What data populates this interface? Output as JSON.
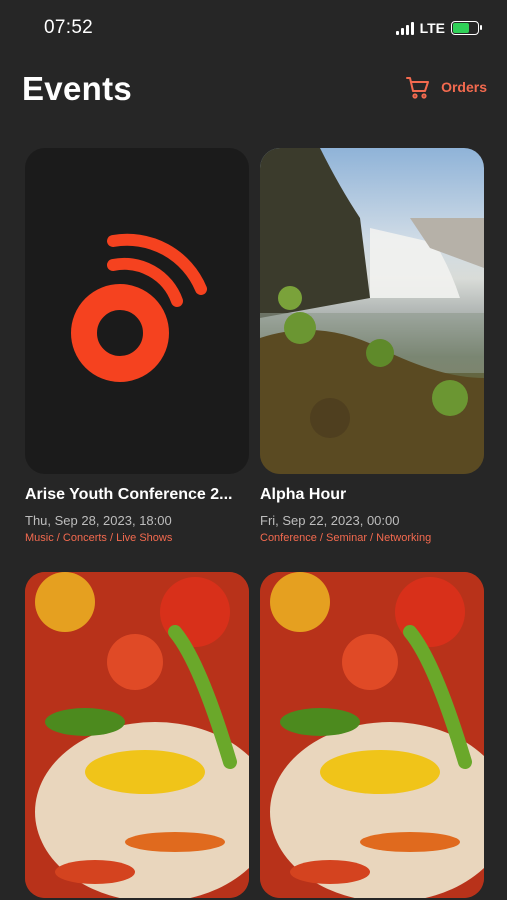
{
  "status": {
    "time": "07:52",
    "network": "LTE"
  },
  "header": {
    "title": "Events",
    "orders_label": "Orders"
  },
  "events": [
    {
      "title": "Arise Youth Conference 2...",
      "date": "Thu, Sep 28, 2023, 18:00",
      "categories": "Music / Concerts / Live Shows",
      "image": "brand-logo"
    },
    {
      "title": "Alpha Hour",
      "date": "Fri, Sep 22, 2023, 00:00",
      "categories": "Conference / Seminar / Networking",
      "image": "waterfall-photo"
    },
    {
      "image": "food-photo"
    },
    {
      "image": "food-photo"
    }
  ],
  "colors": {
    "accent": "#f36a4f",
    "background": "#262626",
    "card": "#1b1b1b"
  }
}
